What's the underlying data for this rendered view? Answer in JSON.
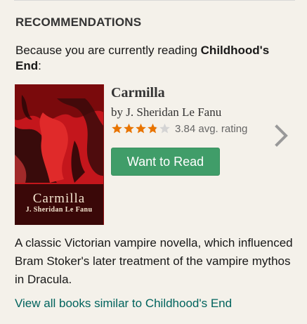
{
  "section": {
    "title": "RECOMMENDATIONS",
    "reading_prefix": "Because you are currently reading ",
    "current_book": "Childhood's End",
    "reading_suffix": ":"
  },
  "book": {
    "cover_title": "Carmilla",
    "cover_author": "J. Sheridan Le Fanu",
    "title": "Carmilla",
    "author": "by J. Sheridan Le Fanu",
    "rating_value": 3.84,
    "rating_text": "3.84 avg. rating",
    "star_count": 5,
    "want_label": "Want to Read",
    "description": "A classic Victorian vampire novella, which influenced Bram Stoker's later treatment of the vampire mythos in Dracula."
  },
  "links": {
    "similar": "View all books similar to Childhood's End"
  },
  "icons": {
    "next": "chevron-right-icon",
    "star": "star-icon"
  },
  "colors": {
    "background": "#f4f1ea",
    "button": "#409d69",
    "link": "#00635d",
    "star_filled": "#e87400",
    "star_empty": "#d4d4d4",
    "cover_red": "#c4161c"
  }
}
